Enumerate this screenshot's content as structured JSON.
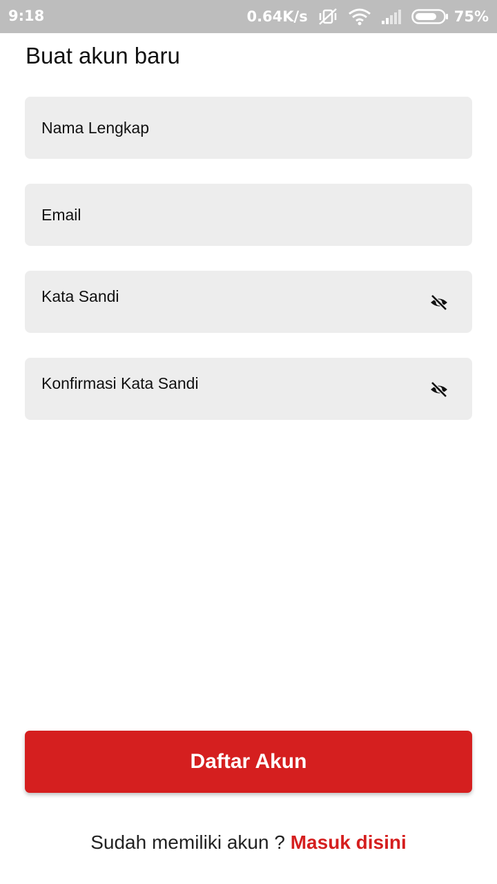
{
  "status_bar": {
    "time": "9:18",
    "network_speed": "0.64K/s",
    "battery": "75%"
  },
  "form": {
    "title": "Buat akun baru",
    "full_name": {
      "placeholder": "Nama Lengkap",
      "value": ""
    },
    "email": {
      "placeholder": "Email",
      "value": ""
    },
    "password": {
      "placeholder": "Kata Sandi",
      "value": ""
    },
    "confirm_password": {
      "placeholder": "Konfirmasi Kata Sandi",
      "value": ""
    }
  },
  "actions": {
    "register_label": "Daftar Akun"
  },
  "footer": {
    "prompt": "Sudah memiliki akun ? ",
    "login_link": "Masuk disini"
  },
  "colors": {
    "accent": "#d51f1f",
    "field_bg": "#ededed",
    "status_bar": "#bdbdbd"
  },
  "icons": {
    "password_toggle": "eye-off-icon",
    "status": [
      "vibrate-off-icon",
      "wifi-icon",
      "signal-icon",
      "battery-icon"
    ]
  }
}
